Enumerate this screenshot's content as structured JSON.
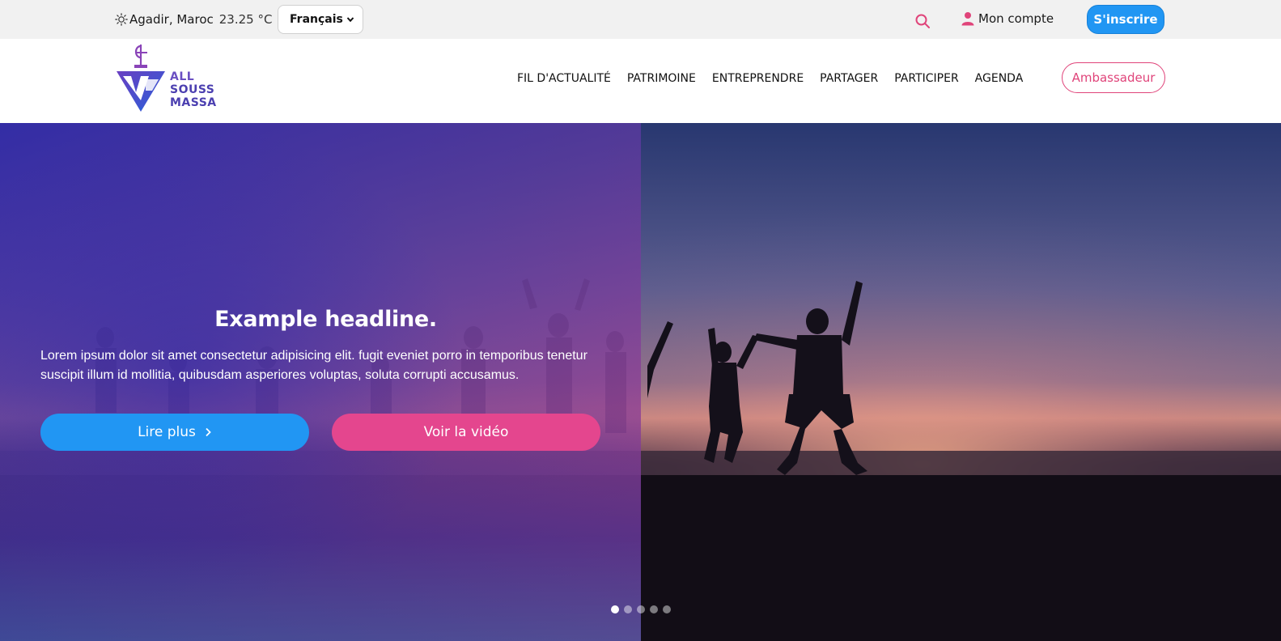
{
  "topbar": {
    "weather_icon": "sun-icon",
    "location": "Agadir, Maroc",
    "temperature": "23.25 °C",
    "language": "Français",
    "search_icon": "search-icon",
    "account_label": "Mon compte",
    "signup_label": "S'inscrire"
  },
  "header": {
    "logo_lines": [
      "ALL",
      "SOUSS",
      "MASSA"
    ],
    "nav": [
      "FIL D'ACTUALITÉ",
      "PATRIMOINE",
      "ENTREPRENDRE",
      "PARTAGER",
      "PARTICIPER",
      "AGENDA"
    ],
    "ambassador_label": "Ambassadeur"
  },
  "hero": {
    "title": "Example headline.",
    "text": "Lorem ipsum dolor sit amet consectetur adipisicing elit. fugit eveniet porro in temporibus tenetur suscipit illum id mollitia, quibusdam asperiores voluptas, soluta corrupti accusamus.",
    "read_more_label": "Lire plus",
    "video_label": "Voir la vidéo",
    "slides_total": 5,
    "active_slide": 1
  },
  "colors": {
    "primary_blue": "#2196f3",
    "accent_pink": "#e4468e",
    "logo_purple": "#4b3fb0"
  }
}
